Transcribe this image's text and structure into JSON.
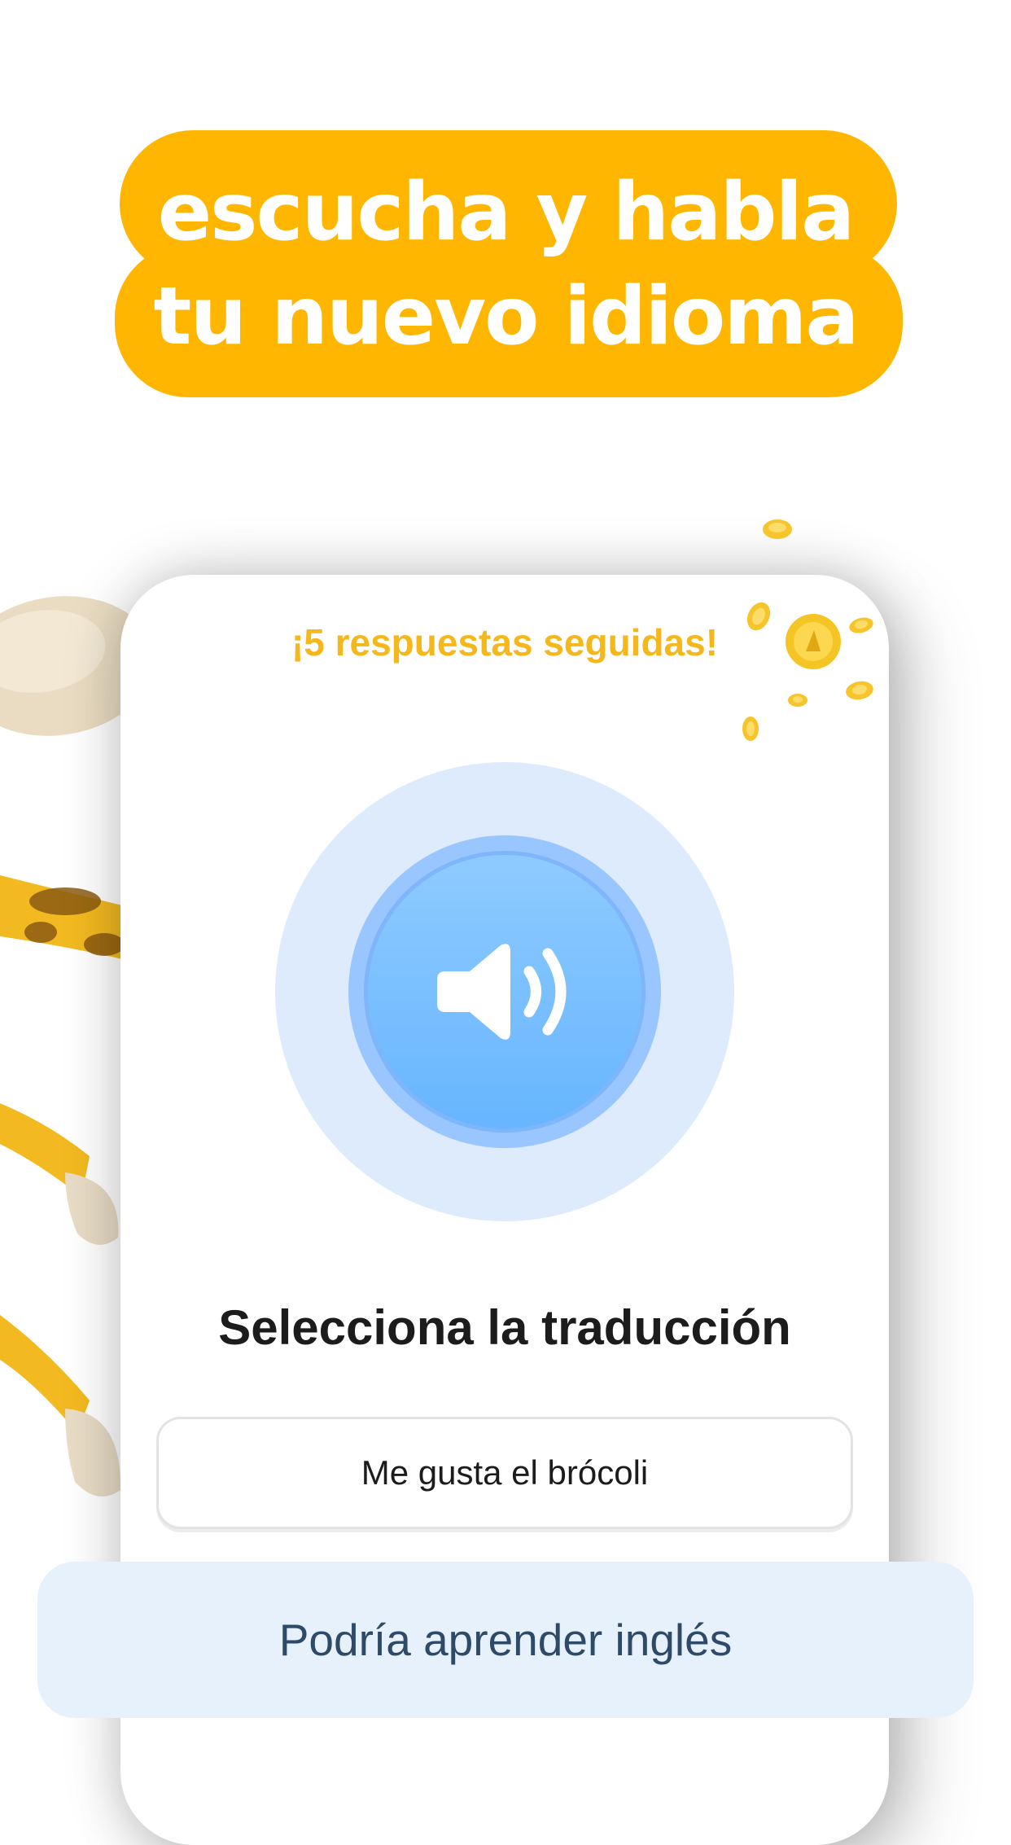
{
  "headline": {
    "line1": "escucha y habla",
    "line2": "tu nuevo idioma"
  },
  "card": {
    "streak_text": "¡5 respuestas seguidas!",
    "prompt": "Selecciona la traducción",
    "option": "Me gusta el brócoli",
    "audio_icon": "speaker-icon"
  },
  "sheet": {
    "text": "Podría aprender inglés"
  },
  "colors": {
    "accent": "#FFB600",
    "streak": "#F5B81C",
    "audio_blue": "#66B5FF",
    "sheet_bg": "#E6F1FC",
    "sheet_text": "#2E4A66"
  }
}
